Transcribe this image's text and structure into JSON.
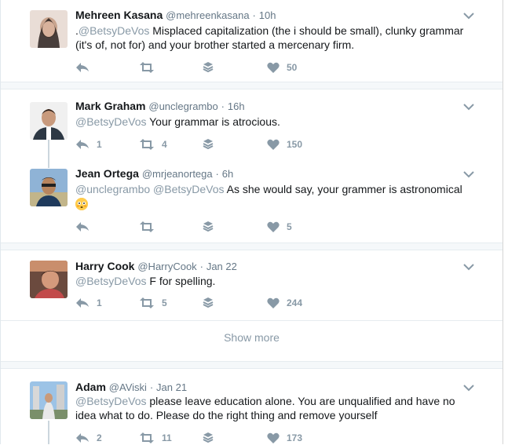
{
  "tweets": [
    {
      "name": "Mehreen Kasana",
      "handle": "@mehreenkasana",
      "time": "10h",
      "text_prefix": ".",
      "mention1": "@BetsyDeVos",
      "mention2": "",
      "text": " Misplaced capitalization (the i should be small), clunky grammar (it's of, not for) and your brother started a mercenary firm.",
      "replies": "",
      "retweets": "",
      "likes": "50",
      "avatar_color": "#d9c7bd"
    },
    {
      "name": "Mark Graham",
      "handle": "@unclegrambo",
      "time": "16h",
      "text_prefix": "",
      "mention1": "@BetsyDeVos",
      "mention2": "",
      "text": " Your grammar is atrocious.",
      "replies": "1",
      "retweets": "4",
      "likes": "150",
      "avatar_color": "#3a4a5c"
    },
    {
      "name": "Jean Ortega",
      "handle": "@mrjeanortega",
      "time": "6h",
      "text_prefix": "",
      "mention1": "@unclegrambo",
      "mention2": "@BetsyDeVos",
      "text": " As she would say, your grammer is astronomical",
      "emoji": "flushed-face",
      "replies": "",
      "retweets": "",
      "likes": "5",
      "avatar_color": "#6b8aa8"
    },
    {
      "name": "Harry Cook",
      "handle": "@HarryCook",
      "time": "Jan 22",
      "text_prefix": "",
      "mention1": "@BetsyDeVos",
      "mention2": "",
      "text": " F for spelling.",
      "replies": "1",
      "retweets": "5",
      "likes": "244",
      "avatar_color": "#b7675a"
    },
    {
      "name": "Adam",
      "handle": "@AViski",
      "time": "Jan 21",
      "text_prefix": "",
      "mention1": "@BetsyDeVos",
      "mention2": "",
      "text": " please leave education alone. You are unqualified and have no idea what to do. Please do the right thing and remove yourself",
      "replies": "2",
      "retweets": "11",
      "likes": "173",
      "avatar_color": "#7aa6c9"
    }
  ],
  "show_more": "Show more",
  "colors": {
    "muted": "#8899a6",
    "handle": "#657786",
    "separator": "#f5f8fa",
    "border": "#e6ecf0"
  },
  "icons": {
    "reply": "reply-icon",
    "retweet": "retweet-icon",
    "stack": "moments-stack-icon",
    "like": "heart-icon",
    "caret": "chevron-down-icon"
  }
}
